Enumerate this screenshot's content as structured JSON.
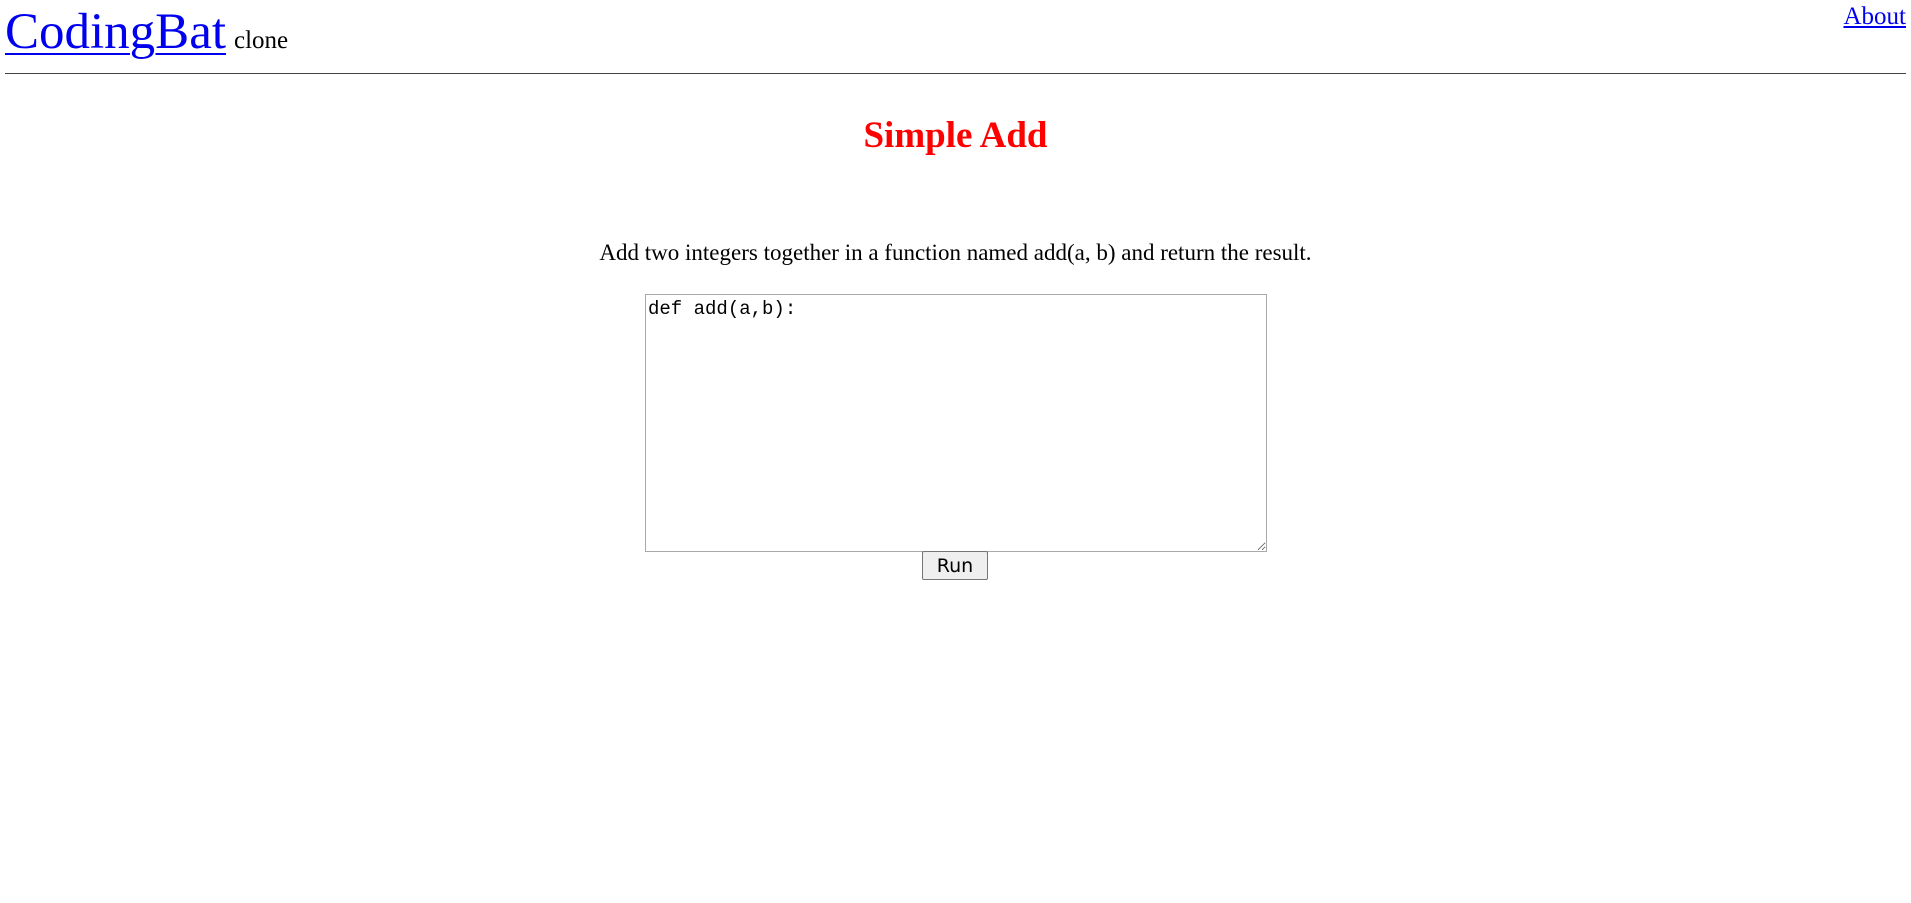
{
  "header": {
    "brand": "CodingBat",
    "brand_sub": "clone",
    "about_link": "About"
  },
  "problem": {
    "title": "Simple Add",
    "description": "Add two integers together in a function named add(a, b) and return the result."
  },
  "editor": {
    "value": "def add(a,b):"
  },
  "actions": {
    "run_label": "Run"
  },
  "colors": {
    "link": "#0000ee",
    "title": "#ff0000",
    "divider": "#444444"
  }
}
